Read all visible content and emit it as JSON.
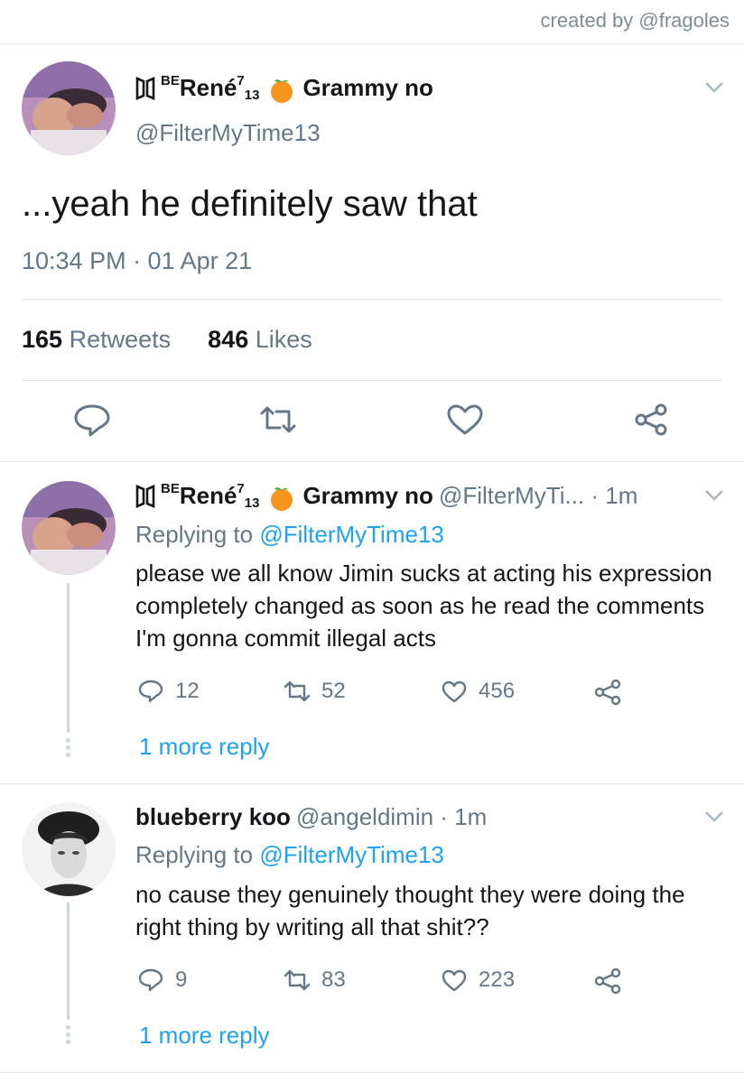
{
  "credit": "created by @fragoles",
  "main_tweet": {
    "display_name_prefix": "BE",
    "display_name": "René",
    "name_sup": "7",
    "name_sub": "13",
    "name_suffix": "Grammy no",
    "handle": "@FilterMyTime13",
    "text": "...yeah he definitely saw that",
    "timestamp": "10:34 PM · 01 Apr 21",
    "retweet_count": "165",
    "retweet_label": "Retweets",
    "like_count": "846",
    "like_label": "Likes"
  },
  "replies": [
    {
      "display_name_prefix": "BE",
      "display_name": "René",
      "name_sup": "7",
      "name_sub": "13",
      "name_suffix": "Grammy no",
      "handle_time": "@FilterMyTi... · 1m",
      "replying_prefix": "Replying to",
      "replying_to": "@FilterMyTime13",
      "text": "please we all know Jimin sucks at acting his expression completely changed as soon as he read the comments I'm gonna commit illegal acts",
      "replies": "12",
      "retweets": "52",
      "likes": "456",
      "more": "1 more reply"
    },
    {
      "display_name": "blueberry koo",
      "handle_time": "@angeldimin · 1m",
      "replying_prefix": "Replying to",
      "replying_to": "@FilterMyTime13",
      "text": "no cause they genuinely thought they were doing the right thing by writing all that shit??",
      "replies": "9",
      "retweets": "83",
      "likes": "223",
      "more": "1 more reply"
    }
  ],
  "icons": [
    "reply-icon",
    "retweet-icon",
    "like-icon",
    "share-icon",
    "chevron-down-icon",
    "tangerine-icon",
    "group-logo-icon"
  ],
  "colors": {
    "accent": "#1da1f2",
    "secondary_text": "#657786",
    "divider": "#e1e8ed"
  }
}
